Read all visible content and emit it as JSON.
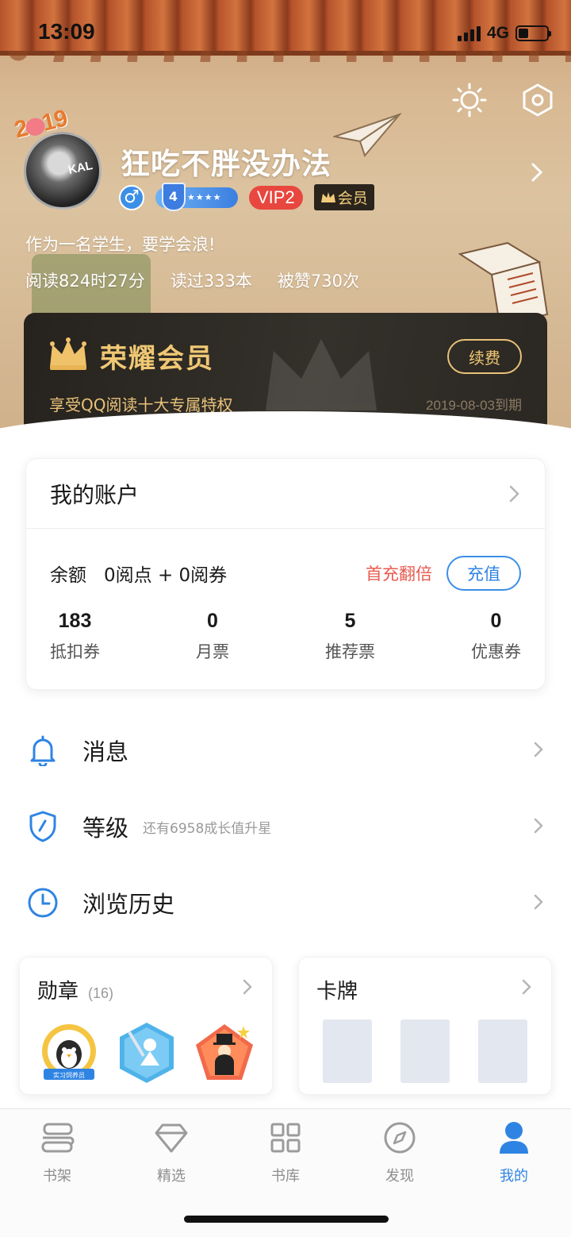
{
  "status_bar": {
    "time": "13:09",
    "network": "4G",
    "battery_level": 0.35
  },
  "profile": {
    "badge_year": "2019",
    "username": "狂吃不胖没办法",
    "gender_symbol": "♂",
    "level": "4",
    "level_stars": "★★★★",
    "vip_label": "VIP2",
    "member_label": "会员",
    "signature": "作为一名学生，要学会浪!",
    "stats": {
      "reading_time": "阅读824时27分",
      "books_read": "读过333本",
      "likes": "被赞730次"
    }
  },
  "vip_card": {
    "title": "荣耀会员",
    "renew_label": "续费",
    "subtitle": "享受QQ阅读十大专属特权",
    "expire": "2019-08-03到期"
  },
  "account": {
    "title": "我的账户",
    "balance_label": "余额",
    "balance_value": "0阅点 + 0阅券",
    "promo": "首充翻倍",
    "recharge_label": "充值",
    "tickets": [
      {
        "value": "183",
        "label": "抵扣券"
      },
      {
        "value": "0",
        "label": "月票"
      },
      {
        "value": "5",
        "label": "推荐票"
      },
      {
        "value": "0",
        "label": "优惠券"
      }
    ]
  },
  "menu": [
    {
      "label": "消息",
      "hint": "",
      "icon": "bell-icon"
    },
    {
      "label": "等级",
      "hint": "还有6958成长值升星",
      "icon": "shield-icon"
    },
    {
      "label": "浏览历史",
      "hint": "",
      "icon": "clock-icon"
    }
  ],
  "medals": {
    "title": "勋章",
    "count": "(16)",
    "medal_badge_text": "实习饲养员"
  },
  "cards": {
    "title": "卡牌"
  },
  "tabs": [
    {
      "label": "书架",
      "icon": "bookshelf-icon"
    },
    {
      "label": "精选",
      "icon": "diamond-icon"
    },
    {
      "label": "书库",
      "icon": "grid-icon"
    },
    {
      "label": "发现",
      "icon": "compass-icon"
    },
    {
      "label": "我的",
      "icon": "person-icon",
      "active": true
    }
  ],
  "colors": {
    "accent": "#2f84e3",
    "gold": "#f0c874",
    "promo_red": "#e85a4f",
    "vip_red": "#e8473f"
  }
}
